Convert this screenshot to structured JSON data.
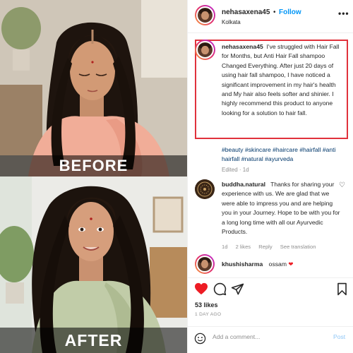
{
  "images": {
    "before_label": "BEFORE",
    "after_label": "AFTER"
  },
  "post": {
    "username": "nehasaxena45",
    "separator": "•",
    "follow_label": "Follow",
    "location": "Kolkata",
    "more_icon": "more-horizontal-icon"
  },
  "caption": {
    "username": "nehasaxena45",
    "text": "I've struggled with Hair Fall for Months, but Anti Hair Fall shampoo Changed Everything. After just 20 days of using hair fall shampoo, I have noticed a significant improvement in my hair's health and  My hair also feels softer and shinier. I highly recommend this product to anyone looking for a solution to hair fall.",
    "highlight_color": "#e0323c",
    "hashtags": "#beauty #skincare #haircare #hairfall #anti hairfall #natural #ayurveda",
    "edited": "Edited · 1d"
  },
  "comments": [
    {
      "username": "buddha.natural",
      "text": "Thanks for sharing your experience with us. We are glad that we were able to impress you and are helping you in your Journey. Hope to be with you for a long long time with all our Ayurvedic Products.",
      "age": "1d",
      "likes": "2 likes",
      "reply_label": "Reply",
      "translate_label": "See translation"
    },
    {
      "username": "khushisharma",
      "text": "ossam",
      "emoji": "❤"
    }
  ],
  "stats": {
    "likes": "53 likes",
    "time_ago": "1 DAY AGO"
  },
  "add_comment": {
    "placeholder": "Add a comment...",
    "post_label": "Post"
  },
  "colors": {
    "link_blue": "#0095f6",
    "hashtag_blue": "#00376b",
    "like_red": "#ed1c24",
    "muted_gray": "#8e8e8e"
  }
}
